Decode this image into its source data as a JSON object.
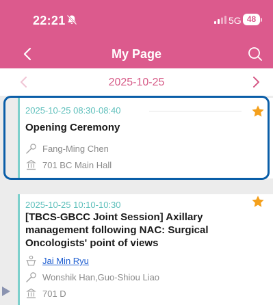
{
  "status_bar": {
    "time": "22:21",
    "network": "5G",
    "battery": "48"
  },
  "nav": {
    "title": "My Page"
  },
  "date_nav": {
    "date": "2025-10-25"
  },
  "sessions": [
    {
      "time": "2025-10-25 08:30-08:40",
      "title": "Opening Ceremony",
      "moderators": "Fang-Ming Chen",
      "location": "701 BC Main Hall",
      "starred": true
    },
    {
      "time": "2025-10-25 10:10-10:30",
      "title": "[TBCS-GBCC Joint Session] Axillary management following NAC: Surgical Oncologists' point of views",
      "speaker": "Jai Min Ryu",
      "moderators": "Wonshik Han,Guo-Shiou Liao",
      "location": "701 D",
      "starred": true
    }
  ],
  "colors": {
    "header": "#dc5a8d",
    "accent_line": "#7dd0cc",
    "star": "#f4a01c",
    "highlight": "#0a5ea8",
    "link": "#1f5fd1"
  },
  "icons": {
    "bell": "bell-slash-icon",
    "signal": "signal-icon",
    "back": "chevron-left-icon",
    "search": "search-icon",
    "star": "star-icon",
    "moderator": "microphone-icon",
    "speaker": "lectern-icon",
    "location": "building-icon"
  }
}
